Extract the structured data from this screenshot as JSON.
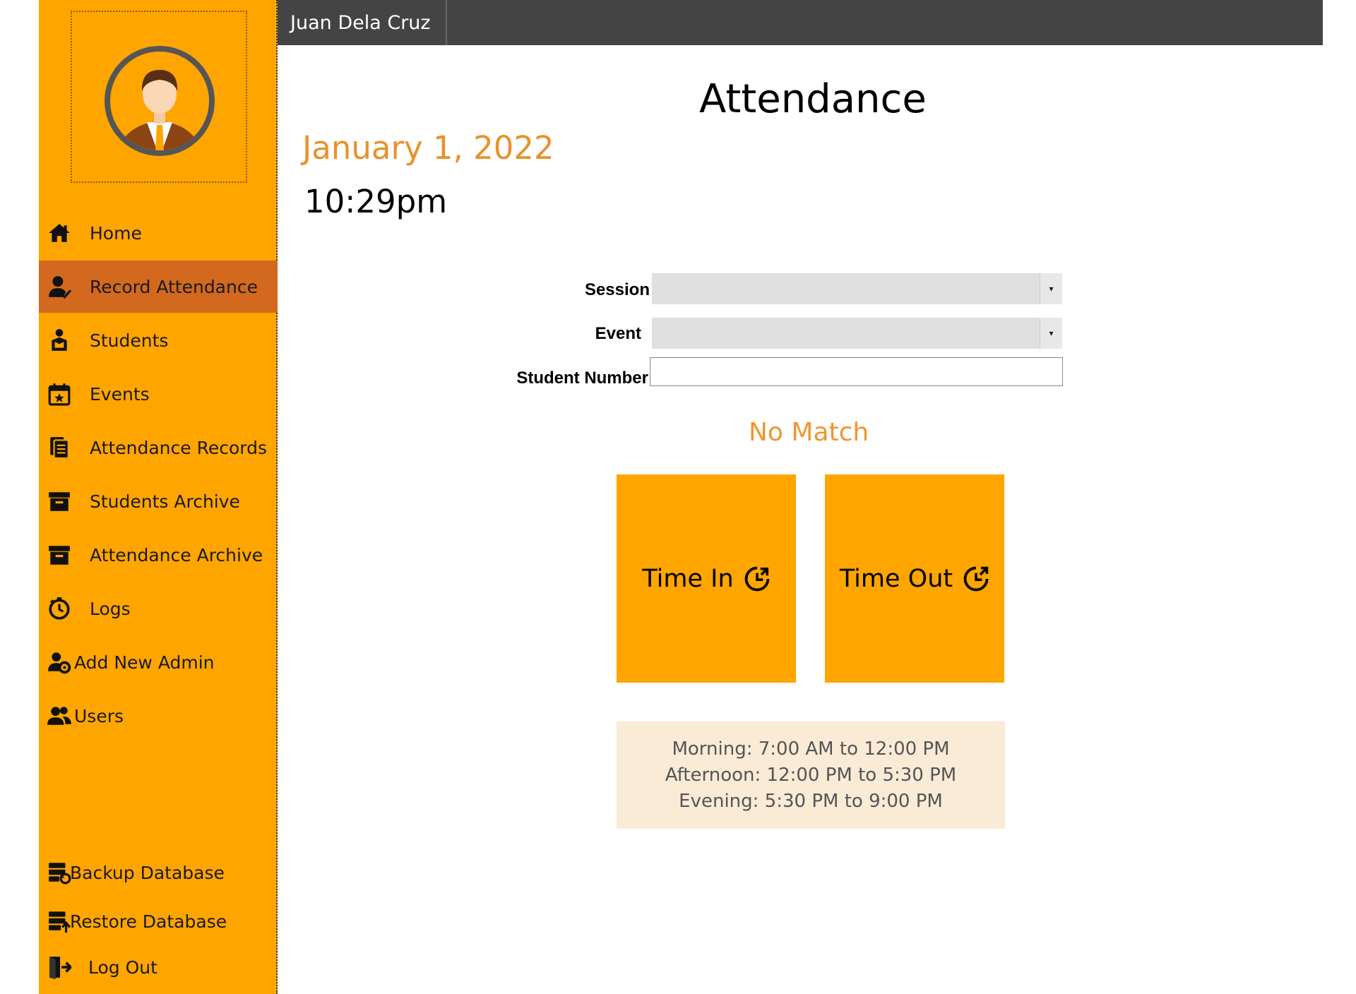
{
  "header": {
    "user_name": "Juan Dela Cruz"
  },
  "sidebar": {
    "items": [
      {
        "label": "Home",
        "icon": "home-icon"
      },
      {
        "label": "Record Attendance",
        "icon": "user-check-icon",
        "active": true
      },
      {
        "label": "Students",
        "icon": "student-icon"
      },
      {
        "label": "Events",
        "icon": "calendar-star-icon"
      },
      {
        "label": "Attendance Records",
        "icon": "documents-icon"
      },
      {
        "label": "Students Archive",
        "icon": "archive-icon"
      },
      {
        "label": "Attendance Archive",
        "icon": "archive-icon"
      },
      {
        "label": "Logs",
        "icon": "stopwatch-icon"
      },
      {
        "label": "Add New Admin",
        "icon": "user-gear-icon"
      },
      {
        "label": "Users",
        "icon": "users-icon"
      }
    ],
    "bottom_items": [
      {
        "label": "Backup Database",
        "icon": "database-backup-icon"
      },
      {
        "label": "Restore Database",
        "icon": "database-restore-icon"
      },
      {
        "label": "Log Out",
        "icon": "logout-icon"
      }
    ]
  },
  "main": {
    "title": "Attendance",
    "date": "January 1, 2022",
    "time": "10:29pm",
    "form": {
      "session_label": "Session",
      "session_value": "",
      "event_label": "Event",
      "event_value": "",
      "student_number_label": "Student Number",
      "student_number_value": ""
    },
    "match_status": "No Match",
    "buttons": {
      "time_in": "Time In",
      "time_out": "Time Out"
    },
    "schedule": [
      "Morning: 7:00 AM to 12:00 PM",
      "Afternoon: 12:00 PM to 5:30 PM",
      "Evening: 5:30 PM to 9:00 PM"
    ]
  },
  "colors": {
    "sidebar_bg": "#FFA500",
    "active_item_bg": "#D2691E",
    "topbar_bg": "#444444",
    "accent_text": "#E8922A",
    "info_bg": "#FAEBD7"
  }
}
